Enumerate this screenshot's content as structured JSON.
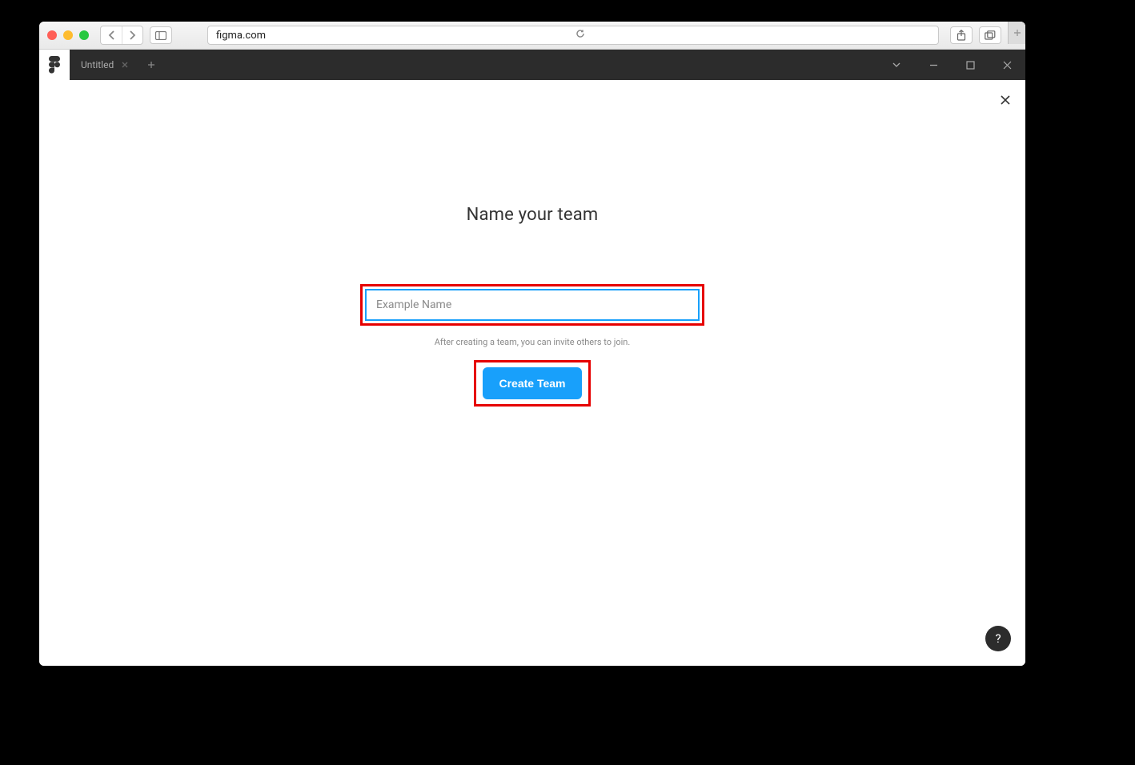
{
  "browser": {
    "url": "figma.com"
  },
  "appbar": {
    "tab_title": "Untitled"
  },
  "dialog": {
    "title": "Name your team",
    "input_placeholder": "Example Name",
    "hint": "After creating a team, you can invite others to join.",
    "create_button": "Create Team"
  },
  "help": {
    "label": "?"
  },
  "colors": {
    "accent": "#18a0fb",
    "highlight": "#e60000",
    "dark_bar": "#2c2c2c"
  }
}
